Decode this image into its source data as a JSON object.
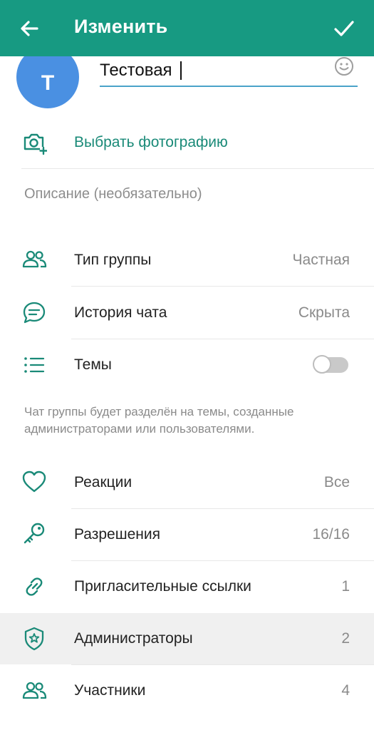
{
  "header": {
    "title": "Изменить",
    "bg_color": "#179a82"
  },
  "profile": {
    "avatar_letter": "Т",
    "avatar_color": "#4a90e2",
    "name_value": "Тестовая",
    "choose_photo_label": "Выбрать фотографию",
    "description_placeholder": "Описание (необязательно)"
  },
  "settings": [
    {
      "label": "Тип группы",
      "value": "Частная",
      "icon": "group-icon"
    },
    {
      "label": "История чата",
      "value": "Скрыта",
      "icon": "chat-bubble-icon"
    },
    {
      "label": "Темы",
      "value": "",
      "icon": "list-icon",
      "toggle": false
    }
  ],
  "topics_hint": "Чат группы будет разделён на темы, созданные администраторами или пользователями.",
  "management": [
    {
      "label": "Реакции",
      "value": "Все",
      "icon": "heart-icon"
    },
    {
      "label": "Разрешения",
      "value": "16/16",
      "icon": "key-icon"
    },
    {
      "label": "Пригласительные ссылки",
      "value": "1",
      "icon": "link-icon"
    },
    {
      "label": "Администраторы",
      "value": "2",
      "icon": "shield-star-icon"
    },
    {
      "label": "Участники",
      "value": "4",
      "icon": "group-icon"
    }
  ],
  "accent_color": "#1a8a78"
}
